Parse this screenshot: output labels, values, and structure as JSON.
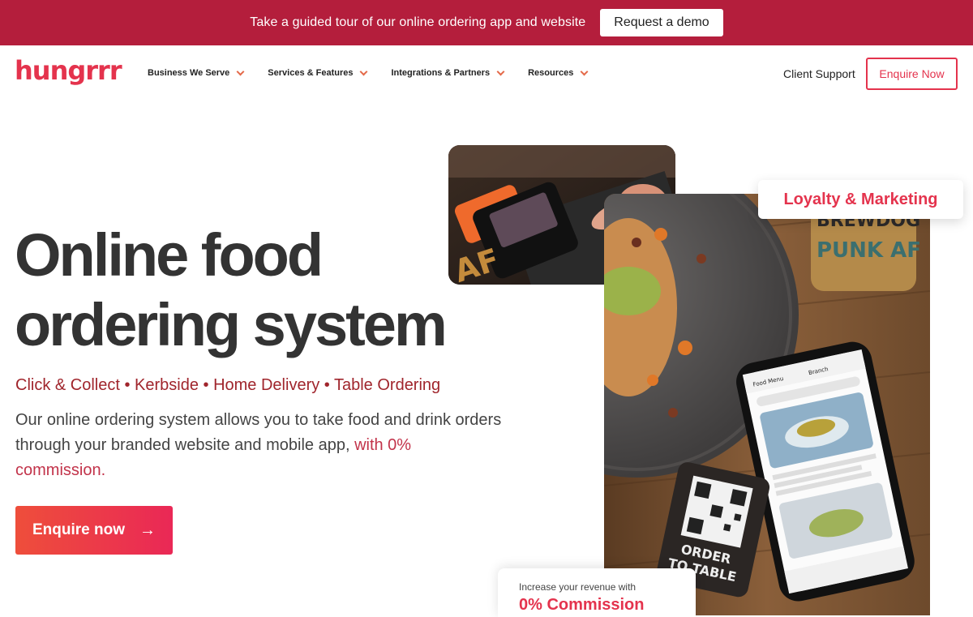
{
  "promo": {
    "text": "Take a guided tour of our online ordering app and website",
    "button": "Request a demo"
  },
  "header": {
    "logo": "hungrrr",
    "nav": [
      {
        "label": "Business We Serve"
      },
      {
        "label": "Services & Features"
      },
      {
        "label": "Integrations & Partners"
      },
      {
        "label": "Resources"
      }
    ],
    "client_support": "Client Support",
    "enquire": "Enquire Now"
  },
  "hero": {
    "title_line1": "Online food",
    "title_line2": "ordering system",
    "subtitle": "Click & Collect • Kerbside • Home Delivery • Table Ordering",
    "desc_main": "Our online ordering system allows you to take food and drink orders through your branded website and mobile app, ",
    "desc_highlight": "with 0% commission.",
    "cta": "Enquire now",
    "cta_arrow": "→"
  },
  "badges": {
    "loyalty": "Loyalty & Marketing",
    "commission_small": "Increase your revenue with",
    "commission_big": "0% Commission"
  },
  "photo_text": {
    "can_brand": "BREWDOG",
    "can_name": "PUNK AF",
    "terminal_mark": "AF",
    "table_sign_line1": "ORDER",
    "table_sign_line2": "TO TABLE",
    "app_header": "Food Menu",
    "app_tab": "Branch"
  },
  "colors": {
    "brand": "#e4334d",
    "promo_bg": "#b41e3c",
    "subtitle": "#a0252c"
  }
}
